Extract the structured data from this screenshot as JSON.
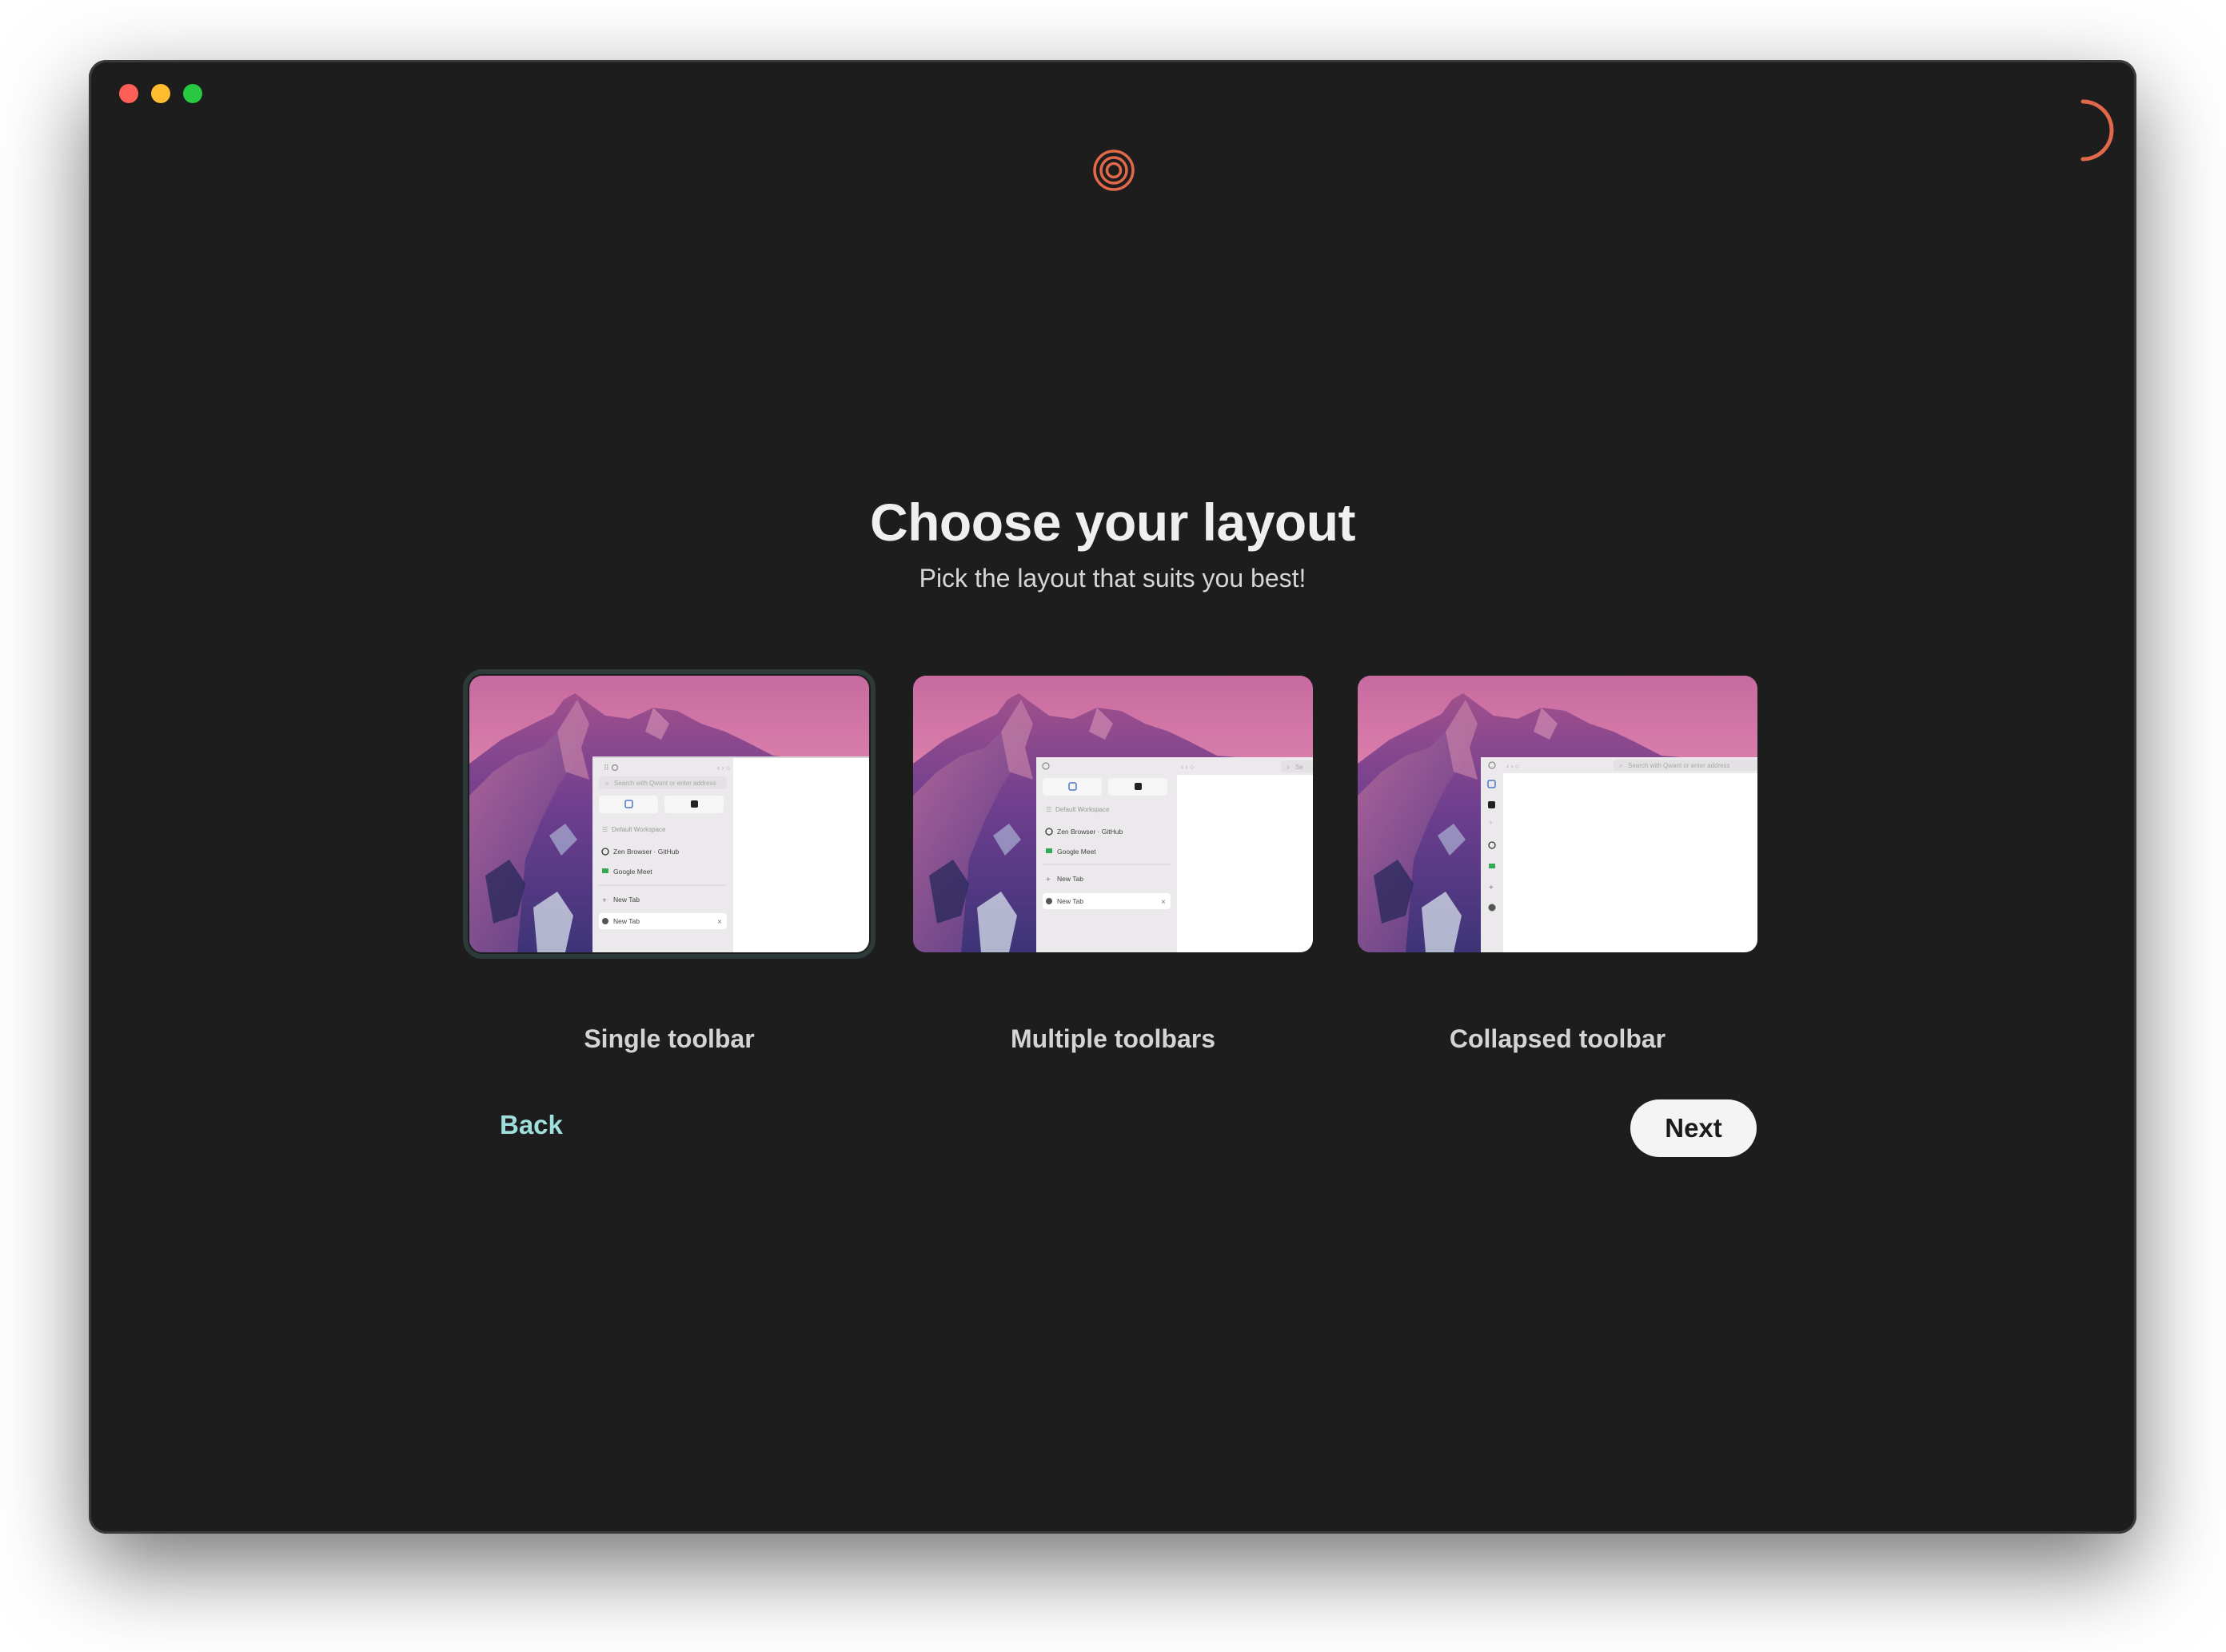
{
  "window": {
    "traffic_lights": [
      "close",
      "minimize",
      "maximize"
    ]
  },
  "header": {
    "logo_icon": "zen-logo-icon",
    "spinner_icon": "loading-spinner-icon",
    "accent_color": "#e0694a"
  },
  "main": {
    "title": "Choose your layout",
    "subtitle": "Pick the layout that suits you best!",
    "layouts": [
      {
        "label": "Single toolbar",
        "selected": true,
        "preview": {
          "search_placeholder": "Search with Qwant or enter address",
          "workspace": "Default Workspace",
          "items": [
            "Zen Browser · GitHub",
            "Google Meet"
          ],
          "new_tab_button": "New Tab",
          "active_tab": "New Tab"
        }
      },
      {
        "label": "Multiple toolbars",
        "selected": false,
        "preview": {
          "search_placeholder": "Se",
          "workspace": "Default Workspace",
          "items": [
            "Zen Browser · GitHub",
            "Google Meet"
          ],
          "new_tab_button": "New Tab",
          "active_tab": "New Tab"
        }
      },
      {
        "label": "Collapsed toolbar",
        "selected": false,
        "preview": {
          "search_placeholder": "Search with Qwant or enter address"
        }
      }
    ]
  },
  "footer": {
    "back_label": "Back",
    "next_label": "Next",
    "back_color": "#9fe0dc"
  }
}
